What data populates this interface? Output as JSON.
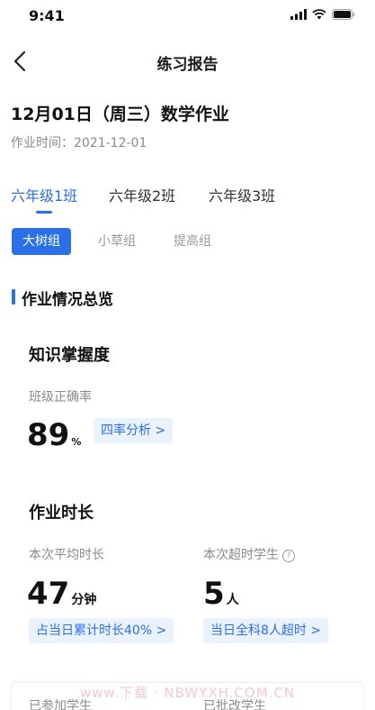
{
  "status_bar": {
    "time": "9:41"
  },
  "nav": {
    "title": "练习报告",
    "back_icon": "chevron-left-icon"
  },
  "homework": {
    "title": "12月01日（周三）数学作业",
    "time_label": "作业时间：2021-12-01"
  },
  "class_tabs": [
    {
      "label": "六年级1班",
      "active": true
    },
    {
      "label": "六年级2班",
      "active": false
    },
    {
      "label": "六年级3班",
      "active": false
    }
  ],
  "groups": [
    {
      "label": "大树组",
      "active": true
    },
    {
      "label": "小草组",
      "active": false
    },
    {
      "label": "提高组",
      "active": false
    }
  ],
  "overview": {
    "section_title": "作业情况总览",
    "knowledge": {
      "title": "知识掌握度",
      "accuracy_label": "班级正确率",
      "accuracy_value": "89",
      "accuracy_unit": "%",
      "analysis_link": "四率分析 >"
    },
    "duration": {
      "title": "作业时长",
      "avg_label": "本次平均时长",
      "avg_value": "47",
      "avg_unit": "分钟",
      "avg_link": "占当日累计时长40% >",
      "overtime_label": "本次超时学生",
      "overtime_value": "5",
      "overtime_unit": "人",
      "overtime_link": "当日全科8人超时 >"
    },
    "bottom": {
      "joined_label": "已参加学生",
      "graded_label": "已批改学生"
    }
  },
  "watermark": "www.下载 · NBWYXH.COM.CN",
  "colors": {
    "accent": "#2b6fe8",
    "pill_bg": "#eaf2fd",
    "muted_text": "#8a8a8a"
  }
}
